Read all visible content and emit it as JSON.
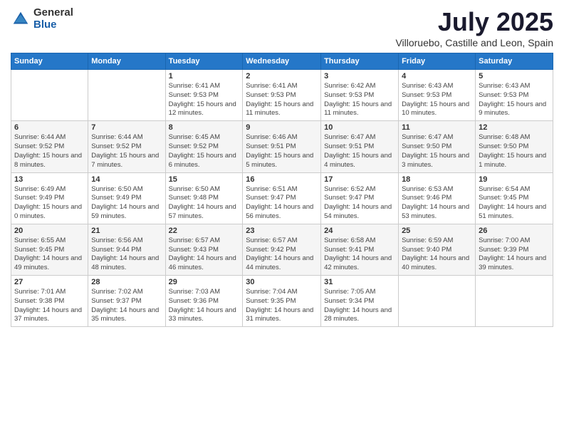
{
  "logo": {
    "general": "General",
    "blue": "Blue"
  },
  "title": "July 2025",
  "subtitle": "Villoruebo, Castille and Leon, Spain",
  "weekdays": [
    "Sunday",
    "Monday",
    "Tuesday",
    "Wednesday",
    "Thursday",
    "Friday",
    "Saturday"
  ],
  "weeks": [
    [
      {
        "day": "",
        "info": ""
      },
      {
        "day": "",
        "info": ""
      },
      {
        "day": "1",
        "info": "Sunrise: 6:41 AM\nSunset: 9:53 PM\nDaylight: 15 hours and 12 minutes."
      },
      {
        "day": "2",
        "info": "Sunrise: 6:41 AM\nSunset: 9:53 PM\nDaylight: 15 hours and 11 minutes."
      },
      {
        "day": "3",
        "info": "Sunrise: 6:42 AM\nSunset: 9:53 PM\nDaylight: 15 hours and 11 minutes."
      },
      {
        "day": "4",
        "info": "Sunrise: 6:43 AM\nSunset: 9:53 PM\nDaylight: 15 hours and 10 minutes."
      },
      {
        "day": "5",
        "info": "Sunrise: 6:43 AM\nSunset: 9:53 PM\nDaylight: 15 hours and 9 minutes."
      }
    ],
    [
      {
        "day": "6",
        "info": "Sunrise: 6:44 AM\nSunset: 9:52 PM\nDaylight: 15 hours and 8 minutes."
      },
      {
        "day": "7",
        "info": "Sunrise: 6:44 AM\nSunset: 9:52 PM\nDaylight: 15 hours and 7 minutes."
      },
      {
        "day": "8",
        "info": "Sunrise: 6:45 AM\nSunset: 9:52 PM\nDaylight: 15 hours and 6 minutes."
      },
      {
        "day": "9",
        "info": "Sunrise: 6:46 AM\nSunset: 9:51 PM\nDaylight: 15 hours and 5 minutes."
      },
      {
        "day": "10",
        "info": "Sunrise: 6:47 AM\nSunset: 9:51 PM\nDaylight: 15 hours and 4 minutes."
      },
      {
        "day": "11",
        "info": "Sunrise: 6:47 AM\nSunset: 9:50 PM\nDaylight: 15 hours and 3 minutes."
      },
      {
        "day": "12",
        "info": "Sunrise: 6:48 AM\nSunset: 9:50 PM\nDaylight: 15 hours and 1 minute."
      }
    ],
    [
      {
        "day": "13",
        "info": "Sunrise: 6:49 AM\nSunset: 9:49 PM\nDaylight: 15 hours and 0 minutes."
      },
      {
        "day": "14",
        "info": "Sunrise: 6:50 AM\nSunset: 9:49 PM\nDaylight: 14 hours and 59 minutes."
      },
      {
        "day": "15",
        "info": "Sunrise: 6:50 AM\nSunset: 9:48 PM\nDaylight: 14 hours and 57 minutes."
      },
      {
        "day": "16",
        "info": "Sunrise: 6:51 AM\nSunset: 9:47 PM\nDaylight: 14 hours and 56 minutes."
      },
      {
        "day": "17",
        "info": "Sunrise: 6:52 AM\nSunset: 9:47 PM\nDaylight: 14 hours and 54 minutes."
      },
      {
        "day": "18",
        "info": "Sunrise: 6:53 AM\nSunset: 9:46 PM\nDaylight: 14 hours and 53 minutes."
      },
      {
        "day": "19",
        "info": "Sunrise: 6:54 AM\nSunset: 9:45 PM\nDaylight: 14 hours and 51 minutes."
      }
    ],
    [
      {
        "day": "20",
        "info": "Sunrise: 6:55 AM\nSunset: 9:45 PM\nDaylight: 14 hours and 49 minutes."
      },
      {
        "day": "21",
        "info": "Sunrise: 6:56 AM\nSunset: 9:44 PM\nDaylight: 14 hours and 48 minutes."
      },
      {
        "day": "22",
        "info": "Sunrise: 6:57 AM\nSunset: 9:43 PM\nDaylight: 14 hours and 46 minutes."
      },
      {
        "day": "23",
        "info": "Sunrise: 6:57 AM\nSunset: 9:42 PM\nDaylight: 14 hours and 44 minutes."
      },
      {
        "day": "24",
        "info": "Sunrise: 6:58 AM\nSunset: 9:41 PM\nDaylight: 14 hours and 42 minutes."
      },
      {
        "day": "25",
        "info": "Sunrise: 6:59 AM\nSunset: 9:40 PM\nDaylight: 14 hours and 40 minutes."
      },
      {
        "day": "26",
        "info": "Sunrise: 7:00 AM\nSunset: 9:39 PM\nDaylight: 14 hours and 39 minutes."
      }
    ],
    [
      {
        "day": "27",
        "info": "Sunrise: 7:01 AM\nSunset: 9:38 PM\nDaylight: 14 hours and 37 minutes."
      },
      {
        "day": "28",
        "info": "Sunrise: 7:02 AM\nSunset: 9:37 PM\nDaylight: 14 hours and 35 minutes."
      },
      {
        "day": "29",
        "info": "Sunrise: 7:03 AM\nSunset: 9:36 PM\nDaylight: 14 hours and 33 minutes."
      },
      {
        "day": "30",
        "info": "Sunrise: 7:04 AM\nSunset: 9:35 PM\nDaylight: 14 hours and 31 minutes."
      },
      {
        "day": "31",
        "info": "Sunrise: 7:05 AM\nSunset: 9:34 PM\nDaylight: 14 hours and 28 minutes."
      },
      {
        "day": "",
        "info": ""
      },
      {
        "day": "",
        "info": ""
      }
    ]
  ]
}
